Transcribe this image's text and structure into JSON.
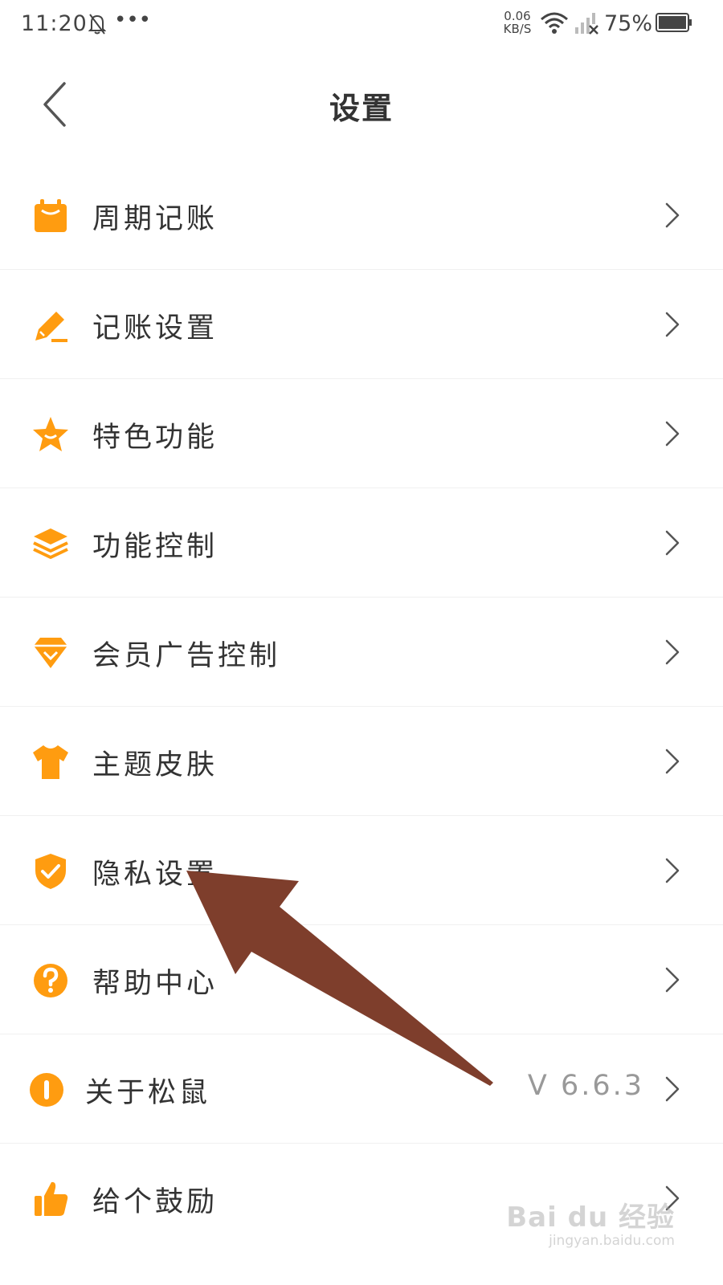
{
  "status_bar": {
    "time": "11:20",
    "more": "•••",
    "net_speed_value": "0.06",
    "net_speed_unit": "KB/S",
    "battery": "75%"
  },
  "header": {
    "title": "设置",
    "back_icon": "chevron-left-icon"
  },
  "accent_color": "#ff9c10",
  "menu": [
    {
      "label": "周期记账",
      "icon": "calendar-icon"
    },
    {
      "label": "记账设置",
      "icon": "pencil-icon"
    },
    {
      "label": "特色功能",
      "icon": "star-icon"
    },
    {
      "label": "功能控制",
      "icon": "layers-icon"
    },
    {
      "label": "会员广告控制",
      "icon": "diamond-icon"
    },
    {
      "label": "主题皮肤",
      "icon": "tshirt-icon"
    },
    {
      "label": "隐私设置",
      "icon": "shield-check-icon"
    },
    {
      "label": "帮助中心",
      "icon": "question-icon"
    },
    {
      "label": "关于松鼠",
      "icon": "info-icon",
      "value": "V  6.6.3"
    },
    {
      "label": "给个鼓励",
      "icon": "thumbs-up-icon"
    }
  ],
  "annotation_color": "#7e3e2c",
  "watermark": {
    "logo": "Bai du 经验",
    "url": "jingyan.baidu.com"
  }
}
